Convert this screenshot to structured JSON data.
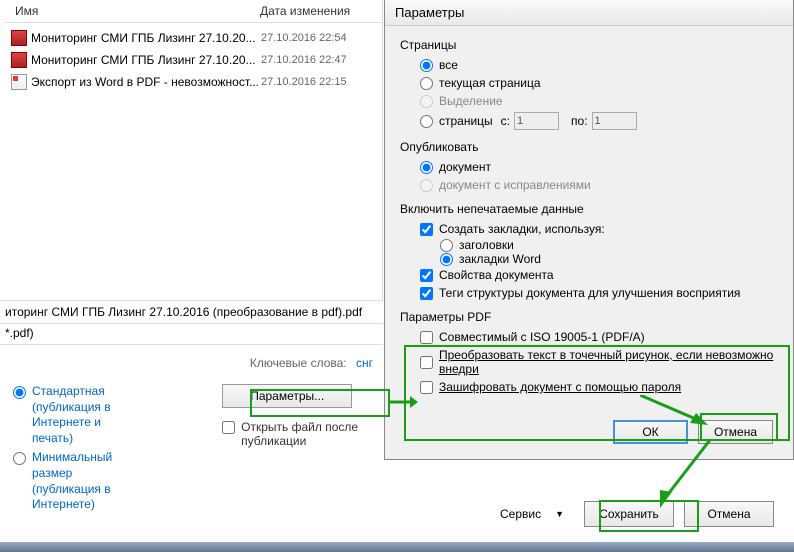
{
  "file_list": {
    "headers": {
      "name": "Имя",
      "date": "Дата изменения"
    },
    "files": [
      {
        "name": "Мониторинг СМИ ГПБ Лизинг 27.10.20...",
        "date": "27.10.2016 22:54",
        "type": "pdf"
      },
      {
        "name": "Мониторинг СМИ ГПБ Лизинг 27.10.20...",
        "date": "27.10.2016 22:47",
        "type": "pdf"
      },
      {
        "name": "Экспорт из Word в PDF - невозможност...",
        "date": "27.10.2016 22:15",
        "type": "word"
      }
    ]
  },
  "filename": "иторинг СМИ ГПБ Лизинг 27.10.2016 (преобразование в pdf).pdf",
  "filter": "*.pdf)",
  "keywords": {
    "label": "Ключевые слова:",
    "value": "снг"
  },
  "optimize": {
    "standard": "Стандартная (публикация в Интернете и печать)",
    "minimal": "Минимальный размер (публикация в Интернете)"
  },
  "param_btn": "Параметры...",
  "open_after": "Открыть файл после публикации",
  "dialog": {
    "title": "Параметры",
    "pages": {
      "label": "Страницы",
      "all": "все",
      "current": "текущая страница",
      "selection": "Выделение",
      "range": "страницы",
      "from_lbl": "с:",
      "from_val": "1",
      "to_lbl": "по:",
      "to_val": "1"
    },
    "publish": {
      "label": "Опубликовать",
      "doc": "документ",
      "doc_markup": "документ с исправлениями"
    },
    "nonprint": {
      "label": "Включить непечатаемые данные",
      "bookmarks": "Создать закладки, используя:",
      "headings": "заголовки",
      "word_bm": "закладки Word",
      "docprops": "Свойства документа",
      "structtags": "Теги структуры документа для улучшения восприятия"
    },
    "pdfparams": {
      "label": "Параметры PDF",
      "iso": "Совместимый с ISO 19005-1 (PDF/A)",
      "bitmap": "Преобразовать текст в точечный рисунок, если невозможно внедри",
      "encrypt": "Зашифровать документ с помощью пароля"
    },
    "ok": "ОК",
    "cancel": "Отмена"
  },
  "bottom": {
    "service": "Сервис",
    "save": "Сохранить",
    "cancel": "Отмена"
  }
}
